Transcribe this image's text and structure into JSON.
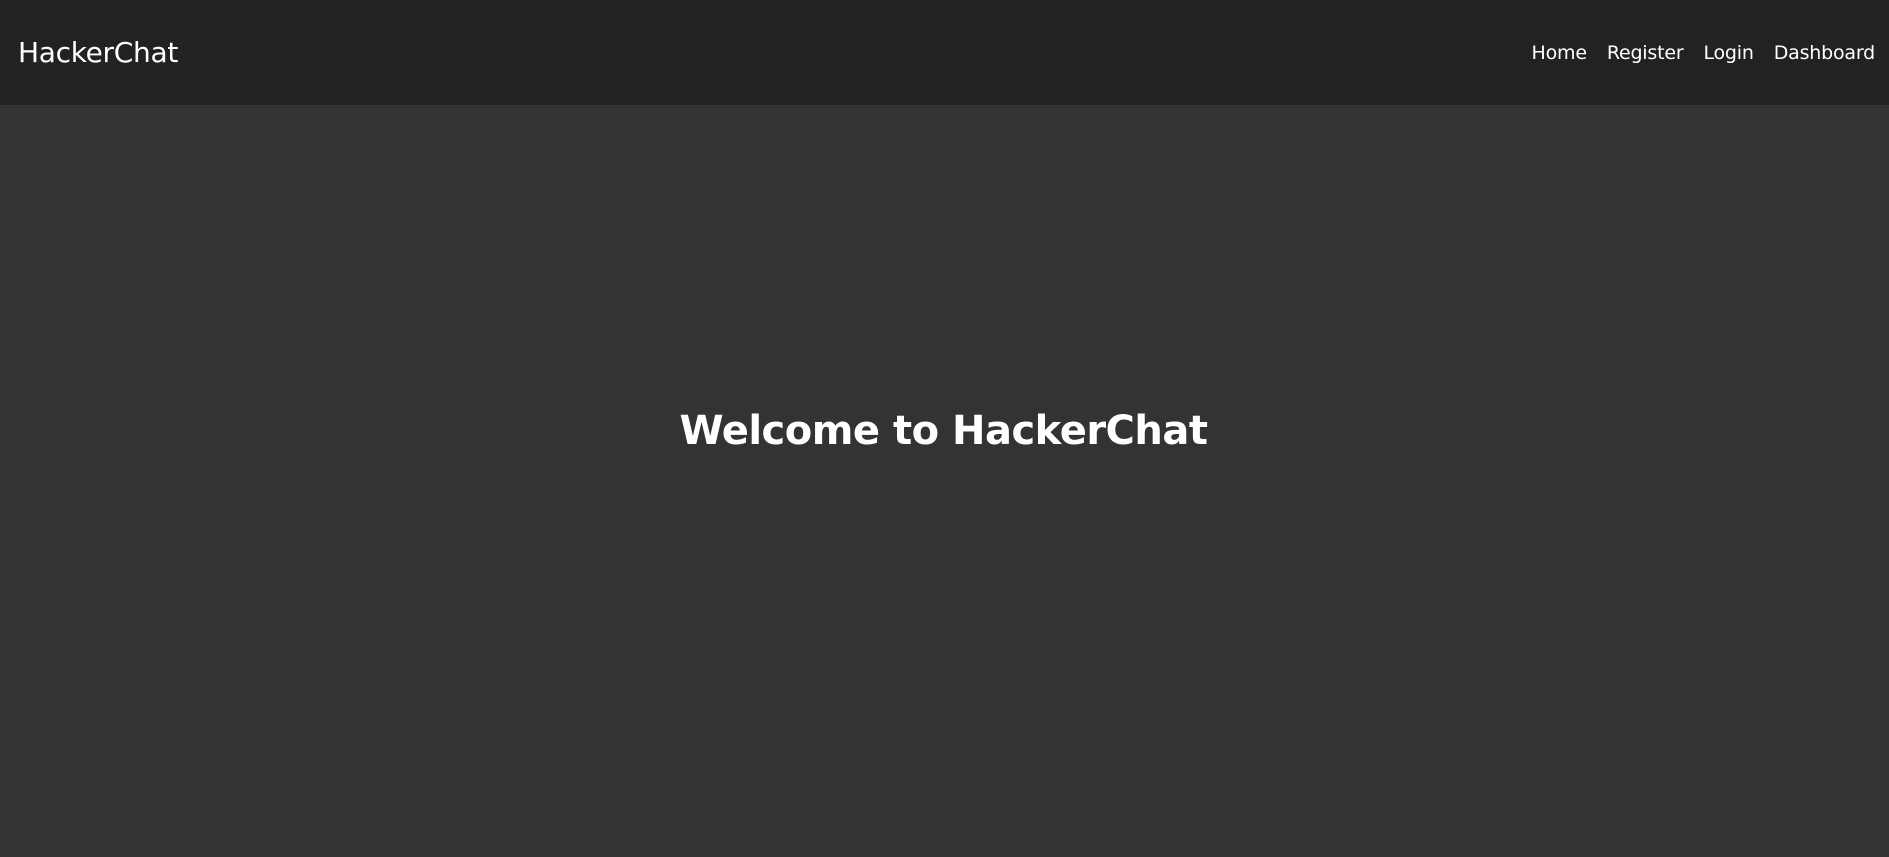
{
  "navbar": {
    "brand": "HackerChat",
    "links": [
      {
        "label": "Home"
      },
      {
        "label": "Register"
      },
      {
        "label": "Login"
      },
      {
        "label": "Dashboard"
      }
    ]
  },
  "main": {
    "heading": "Welcome to HackerChat"
  },
  "colors": {
    "navbar_bg": "#222222",
    "page_bg": "#333333",
    "text": "#ffffff"
  }
}
